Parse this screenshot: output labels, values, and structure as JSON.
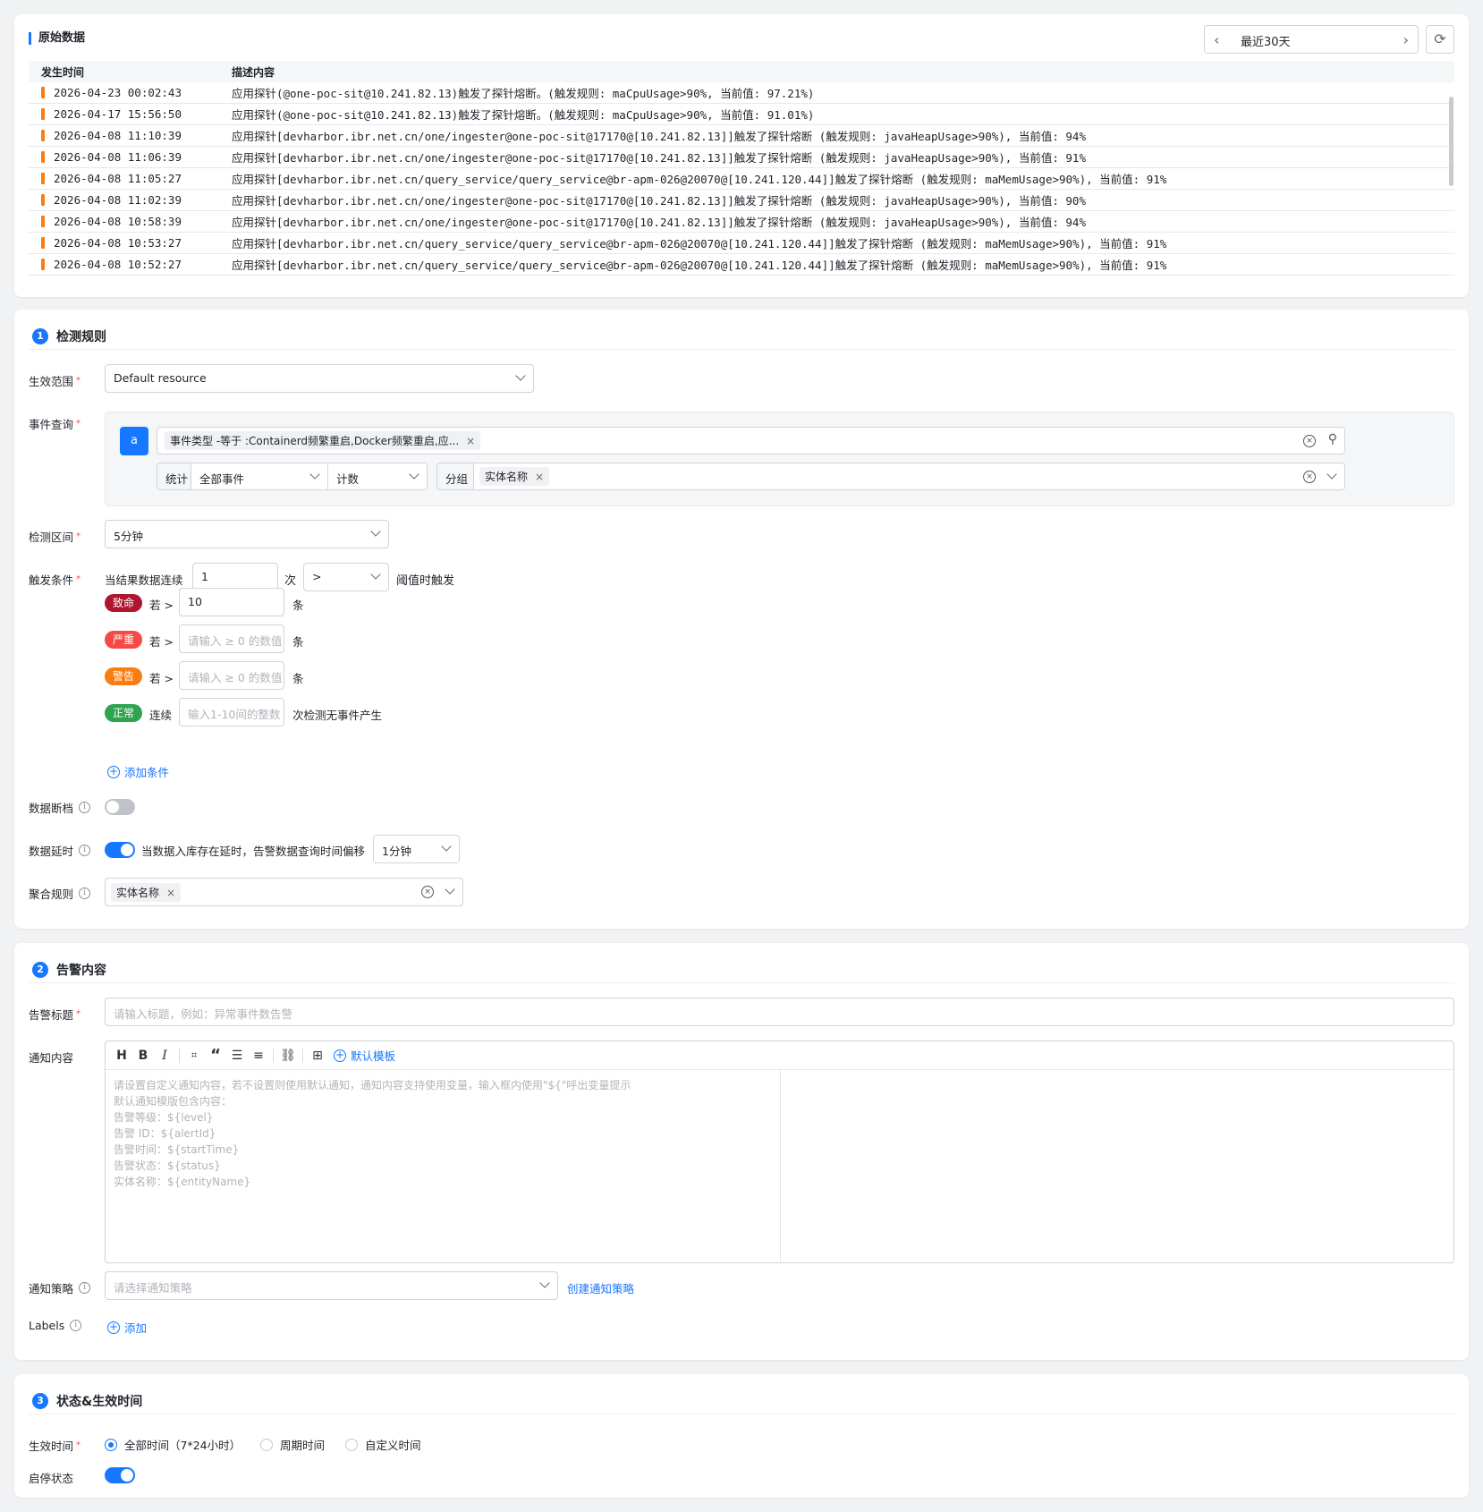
{
  "raw": {
    "title": "原始数据",
    "range": "最近30天",
    "columns": [
      "发生时间",
      "描述内容"
    ],
    "rows": [
      {
        "time": "2026-04-23 00:02:43",
        "desc": "应用探针(@one-poc-sit@10.241.82.13)触发了探针熔断。(触发规则: maCpuUsage>90%, 当前值: 97.21%)"
      },
      {
        "time": "2026-04-17 15:56:50",
        "desc": "应用探针(@one-poc-sit@10.241.82.13)触发了探针熔断。(触发规则: maCpuUsage>90%, 当前值: 91.01%)"
      },
      {
        "time": "2026-04-08 11:10:39",
        "desc": "应用探针[devharbor.ibr.net.cn/one/ingester@one-poc-sit@17170@[10.241.82.13]]触发了探针熔断 (触发规则:  javaHeapUsage>90%), 当前值: 94%"
      },
      {
        "time": "2026-04-08 11:06:39",
        "desc": "应用探针[devharbor.ibr.net.cn/one/ingester@one-poc-sit@17170@[10.241.82.13]]触发了探针熔断 (触发规则:  javaHeapUsage>90%), 当前值: 91%"
      },
      {
        "time": "2026-04-08 11:05:27",
        "desc": "应用探针[devharbor.ibr.net.cn/query_service/query_service@br-apm-026@20070@[10.241.120.44]]触发了探针熔断 (触发规则:  maMemUsage>90%), 当前值: 91%"
      },
      {
        "time": "2026-04-08 11:02:39",
        "desc": "应用探针[devharbor.ibr.net.cn/one/ingester@one-poc-sit@17170@[10.241.82.13]]触发了探针熔断 (触发规则:  javaHeapUsage>90%), 当前值: 90%"
      },
      {
        "time": "2026-04-08 10:58:39",
        "desc": "应用探针[devharbor.ibr.net.cn/one/ingester@one-poc-sit@17170@[10.241.82.13]]触发了探针熔断 (触发规则:  javaHeapUsage>90%), 当前值: 94%"
      },
      {
        "time": "2026-04-08 10:53:27",
        "desc": "应用探针[devharbor.ibr.net.cn/query_service/query_service@br-apm-026@20070@[10.241.120.44]]触发了探针熔断 (触发规则:  maMemUsage>90%), 当前值: 91%"
      },
      {
        "time": "2026-04-08 10:52:27",
        "desc": "应用探针[devharbor.ibr.net.cn/query_service/query_service@br-apm-026@20070@[10.241.120.44]]触发了探针熔断 (触发规则:  maMemUsage>90%), 当前值: 91%"
      }
    ]
  },
  "rule": {
    "num": "1",
    "title": "检测规则",
    "scope_label": "生效范围",
    "scope_value": "Default resource",
    "query_label": "事件查询",
    "query_letter": "a",
    "query_tag": "事件类型 -等于 :Containerd频繁重启,Docker频繁重启,应...",
    "stat_label": "统计",
    "stat_value": "全部事件",
    "agg_value": "计数",
    "group_label": "分组",
    "group_tag": "实体名称",
    "interval_label": "检测区间",
    "interval_value": "5分钟",
    "trigger_label": "触发条件",
    "trigger_prefix": "当结果数据连续",
    "trigger_count": "1",
    "trigger_times": "次",
    "trigger_op": ">",
    "trigger_suffix": "阈值时触发",
    "levels": [
      {
        "name": "致命",
        "cond": "若 >",
        "value": "10",
        "placeholder": "",
        "unit": "条",
        "color": "#b0152f"
      },
      {
        "name": "严重",
        "cond": "若 >",
        "value": "",
        "placeholder": "请输入 ≥ 0 的数值",
        "unit": "条",
        "color": "#f54a45"
      },
      {
        "name": "警告",
        "cond": "若 >",
        "value": "",
        "placeholder": "请输入 ≥ 0 的数值",
        "unit": "条",
        "color": "#fa7d14"
      },
      {
        "name": "正常",
        "cond": "连续",
        "value": "",
        "placeholder": "输入1-10间的整数",
        "unit": "次检测无事件产生",
        "color": "#2ea44f"
      }
    ],
    "add_condition": "添加条件",
    "gap_label": "数据断档",
    "delay_label": "数据延时",
    "delay_text": "当数据入库存在延时，告警数据查询时间偏移",
    "delay_value": "1分钟",
    "aggregate_label": "聚合规则",
    "aggregate_tag": "实体名称"
  },
  "alert": {
    "num": "2",
    "title": "告警内容",
    "title_label": "告警标题",
    "title_placeholder": "请输入标题，例如：异常事件数告警",
    "content_label": "通知内容",
    "template_btn": "默认模板",
    "editor_placeholder": [
      "请设置自定义通知内容，若不设置则使用默认通知，通知内容支持使用变量，输入框内使用\"${\"呼出变量提示",
      "默认通知模版包含内容：",
      "告警等级：${level}",
      "告警 ID：${alertId}",
      "告警时间：${startTime}",
      "告警状态：${status}",
      "实体名称：${entityName}"
    ],
    "policy_label": "通知策略",
    "policy_placeholder": "请选择通知策略",
    "policy_link": "创建通知策略",
    "labels_label": "Labels",
    "labels_add": "添加"
  },
  "status": {
    "num": "3",
    "title": "状态&生效时间",
    "time_label": "生效时间",
    "options": [
      "全部时间（7*24小时）",
      "周期时间",
      "自定义时间"
    ],
    "selected": "全部时间（7*24小时）",
    "enable_label": "启停状态"
  },
  "colors": {
    "accent": "#1677ff",
    "row_marker": "#fa7d14"
  }
}
